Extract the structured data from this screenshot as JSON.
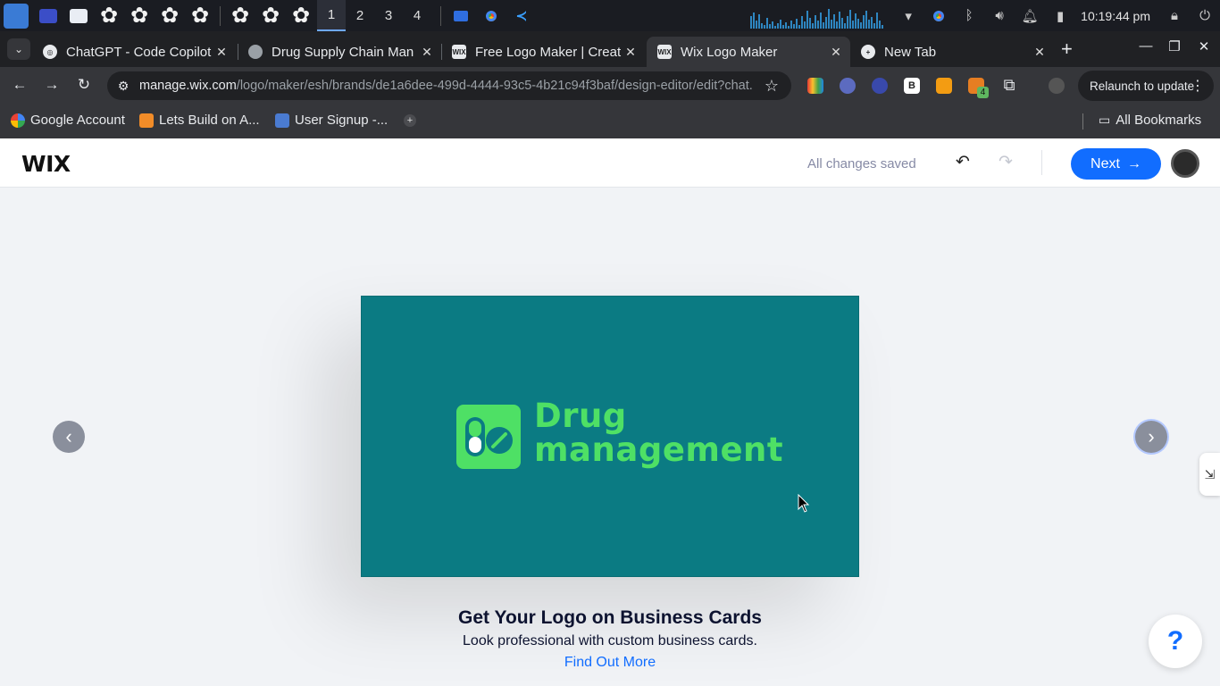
{
  "taskbar": {
    "workspaces": [
      "1",
      "2",
      "3",
      "4"
    ],
    "clock": "10:19:44 pm"
  },
  "tabs": [
    {
      "title": "ChatGPT - Code Copilot"
    },
    {
      "title": "Drug Supply Chain Man"
    },
    {
      "title": "Free Logo Maker | Creat"
    },
    {
      "title": "Wix Logo Maker"
    },
    {
      "title": "New Tab"
    }
  ],
  "address": {
    "host": "manage.wix.com",
    "path": "/logo/maker/esh/brands/de1a6dee-499d-4444-93c5-4b21c94f3baf/design-editor/edit?chat..."
  },
  "relaunch_label": "Relaunch to update",
  "extensions": {
    "badge": "4",
    "b_label": "B"
  },
  "bookmarks": [
    {
      "label": "Google Account"
    },
    {
      "label": "Lets Build on A..."
    },
    {
      "label": "User Signup -..."
    }
  ],
  "all_bookmarks": "All Bookmarks",
  "wix": {
    "logo": "WIX",
    "save_status": "All changes saved",
    "next_label": "Next",
    "next_arrow": "→"
  },
  "card": {
    "line1": "Drug",
    "line2": "management",
    "background": "#0b7b83",
    "accent": "#4ee065"
  },
  "promo": {
    "title": "Get Your Logo on Business Cards",
    "subtitle": "Look professional with custom business cards.",
    "link": "Find Out More"
  },
  "help_label": "?"
}
